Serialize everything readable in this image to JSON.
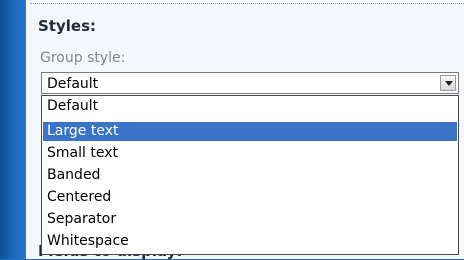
{
  "section": {
    "title": "Styles:"
  },
  "group_style": {
    "label": "Group style:",
    "selected_value": "Default",
    "options": [
      "Default",
      "Large text",
      "Small text",
      "Banded",
      "Centered",
      "Separator",
      "Whitespace"
    ],
    "highlighted_option": "Large text"
  },
  "partially_hidden_label": "Fields to display:",
  "colors": {
    "background_blue": "#1565b4",
    "highlight": "#3a74c8",
    "panel": "#f4f7fb"
  },
  "icons": {
    "dropdown_arrow": "chevron-down-icon"
  }
}
